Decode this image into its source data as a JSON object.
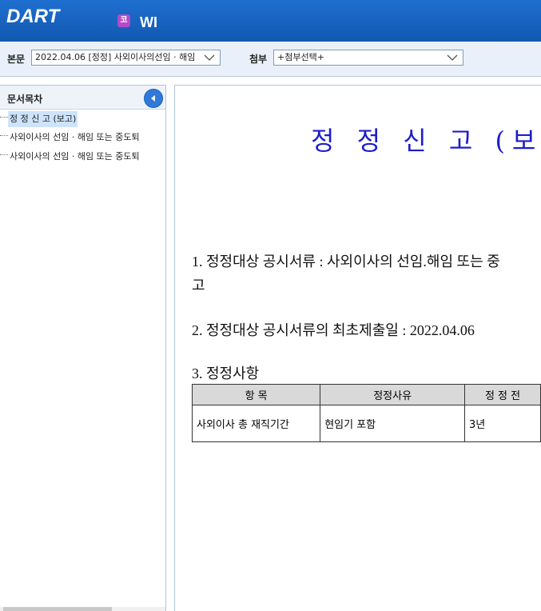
{
  "header": {
    "logo_text": "DART",
    "company_badge": "코",
    "company_name": "WI"
  },
  "toolbar": {
    "body_label": "본문",
    "body_select_value": "2022.04.06 [정정] 사외이사의선임 · 해임",
    "attach_label": "첨부",
    "attach_select_value": "+첨부선택+"
  },
  "sidebar": {
    "title": "문서목차",
    "items": [
      {
        "label": "정 정 신 고 (보고)"
      },
      {
        "label": "사외이사의 선임 · 해임 또는 중도퇴"
      },
      {
        "label": "사외이사의 선임 · 해임 또는 중도퇴"
      }
    ]
  },
  "document": {
    "title": "정 정 신 고 (보고)",
    "item1": "1. 정정대상 공시서류 : 사외이사의 선임.해임 또는 중",
    "item1_wrap": "고",
    "item2": "2. 정정대상 공시서류의 최초제출일 : 2022.04.06",
    "item3": "3. 정정사항",
    "table": {
      "headers": [
        "항  목",
        "정정사유",
        "정 정 전"
      ],
      "rows": [
        [
          "사외이사 총 재직기간",
          "현임기 포함",
          "3년"
        ]
      ]
    }
  },
  "colors": {
    "header_bg": "#1e6fd0",
    "title_blue": "#1d1dcc",
    "toc_active_bg": "#cde4fb"
  }
}
